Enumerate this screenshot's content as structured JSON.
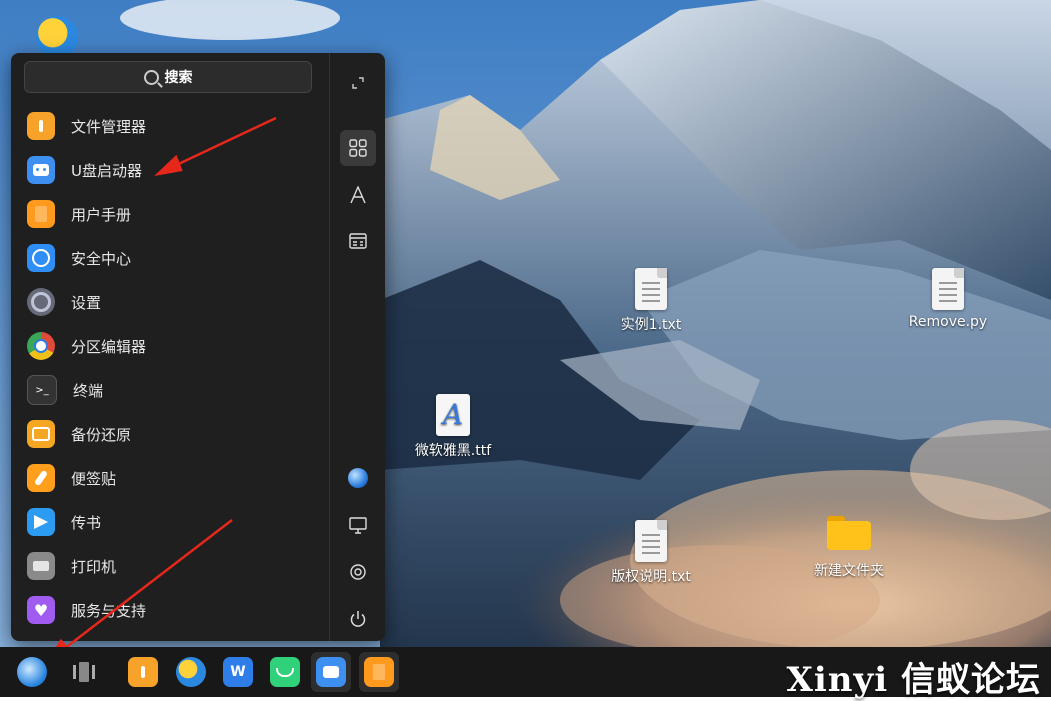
{
  "start_menu": {
    "search": {
      "placeholder": "搜索"
    },
    "apps": [
      {
        "label": "文件管理器",
        "icon": "file-manager-icon",
        "color": "#f7a32a"
      },
      {
        "label": "U盘启动器",
        "icon": "usb-launcher-icon",
        "color": "#3d8ff0"
      },
      {
        "label": "用户手册",
        "icon": "user-manual-icon",
        "color": "#ff9a1e"
      },
      {
        "label": "安全中心",
        "icon": "security-center-icon",
        "color": "#2f8ef5"
      },
      {
        "label": "设置",
        "icon": "settings-icon",
        "color": "#666a78"
      },
      {
        "label": "分区编辑器",
        "icon": "partition-editor-icon",
        "color": "#e04a3a"
      },
      {
        "label": "终端",
        "icon": "terminal-icon",
        "color": "#333333"
      },
      {
        "label": "备份还原",
        "icon": "backup-restore-icon",
        "color": "#f5a623"
      },
      {
        "label": "便签贴",
        "icon": "sticky-notes-icon",
        "color": "#ff9f1c"
      },
      {
        "label": "传书",
        "icon": "send-file-icon",
        "color": "#2b9cf2"
      },
      {
        "label": "打印机",
        "icon": "printer-icon",
        "color": "#8a8a8a"
      },
      {
        "label": "服务与支持",
        "icon": "service-support-icon",
        "color": "#a05cf0"
      }
    ],
    "sidebar": [
      {
        "name": "fullscreen-icon"
      },
      {
        "name": "grid-view-icon"
      },
      {
        "name": "letter-sort-icon"
      },
      {
        "name": "category-view-icon"
      },
      {
        "name": "browser-icon"
      },
      {
        "name": "computer-icon"
      },
      {
        "name": "gear-icon"
      },
      {
        "name": "power-icon"
      }
    ]
  },
  "desktop_icons": [
    {
      "label": "实例1.txt",
      "type": "text-file-icon"
    },
    {
      "label": "Remove.py",
      "type": "python-file-icon"
    },
    {
      "label": "微软雅黑.ttf",
      "type": "font-file-icon"
    },
    {
      "label": "版权说明.txt",
      "type": "text-file-icon"
    },
    {
      "label": "新建文件夹",
      "type": "folder-icon"
    }
  ],
  "taskbar": {
    "items": [
      {
        "name": "start-menu-button"
      },
      {
        "name": "multitask-view-button"
      },
      {
        "name": "file-manager-taskbar"
      },
      {
        "name": "browser-taskbar"
      },
      {
        "name": "wps-office-taskbar"
      },
      {
        "name": "app-store-taskbar"
      },
      {
        "name": "usb-launcher-taskbar"
      },
      {
        "name": "user-manual-taskbar"
      }
    ]
  },
  "watermark": "Xinyi 信蚁论坛",
  "colors": {
    "menu_bg": "#1f1f1f",
    "taskbar_bg": "#181818",
    "arrow": "#e8271b"
  }
}
